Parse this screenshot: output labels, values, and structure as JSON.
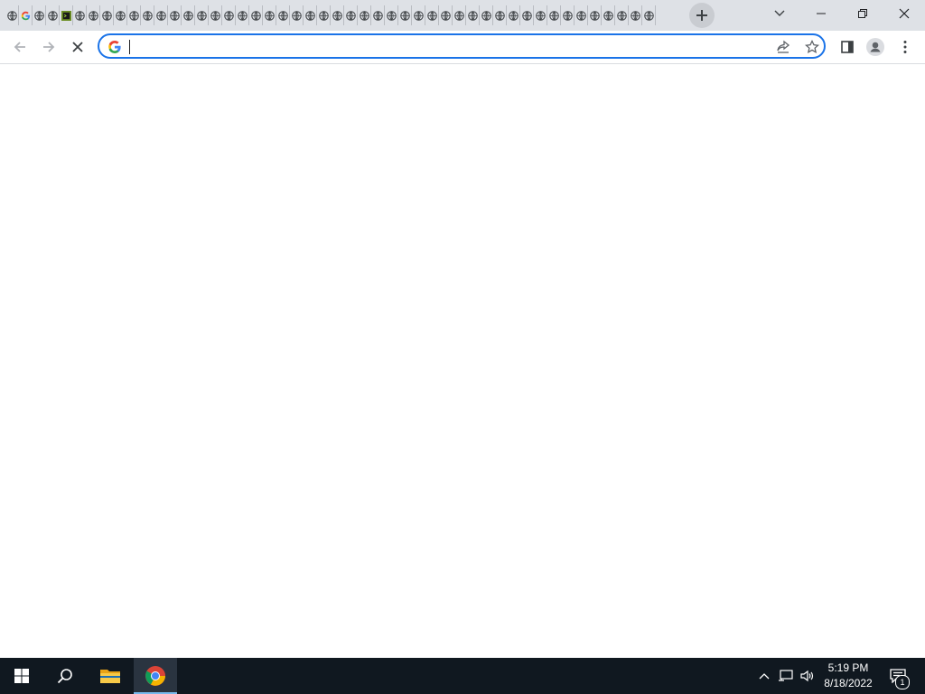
{
  "browser": {
    "tab_count": 48,
    "tab_favicons": [
      "globe",
      "google",
      "globe",
      "globe",
      "terminal",
      "globe",
      "globe",
      "globe",
      "globe",
      "globe",
      "globe",
      "globe",
      "globe",
      "globe",
      "globe",
      "globe",
      "globe",
      "globe",
      "globe",
      "globe",
      "globe",
      "globe",
      "globe",
      "globe",
      "globe",
      "globe",
      "globe",
      "globe",
      "globe",
      "globe",
      "globe",
      "globe",
      "globe",
      "globe",
      "globe",
      "globe",
      "globe",
      "globe",
      "globe",
      "globe",
      "globe",
      "globe",
      "globe",
      "globe",
      "globe",
      "globe",
      "globe",
      "globe"
    ],
    "new_tab_icon": "plus-icon",
    "tab_search_icon": "chevron-down-icon",
    "window_controls": [
      "minimize-icon",
      "restore-icon",
      "close-icon"
    ],
    "toolbar": {
      "back_icon": "back-arrow-icon",
      "forward_icon": "forward-arrow-icon",
      "stop_icon": "stop-loading-icon",
      "address_value": "",
      "address_placeholder": "",
      "share_icon": "share-icon",
      "bookmark_icon": "star-icon",
      "side_panel_icon": "side-panel-icon",
      "profile_icon": "profile-icon",
      "menu_icon": "kebab-menu-icon"
    },
    "accent_color": "#1a73e8"
  },
  "taskbar": {
    "start_icon": "windows-start-icon",
    "search_icon": "search-icon",
    "pinned": [
      "file-explorer-icon",
      "chrome-icon"
    ],
    "active_app": "chrome",
    "tray_icons": [
      "chevron-up-icon",
      "network-icon",
      "volume-icon"
    ],
    "clock": {
      "time": "5:19 PM",
      "date": "8/18/2022"
    },
    "notification_count": "1",
    "background_color": "#101820"
  }
}
